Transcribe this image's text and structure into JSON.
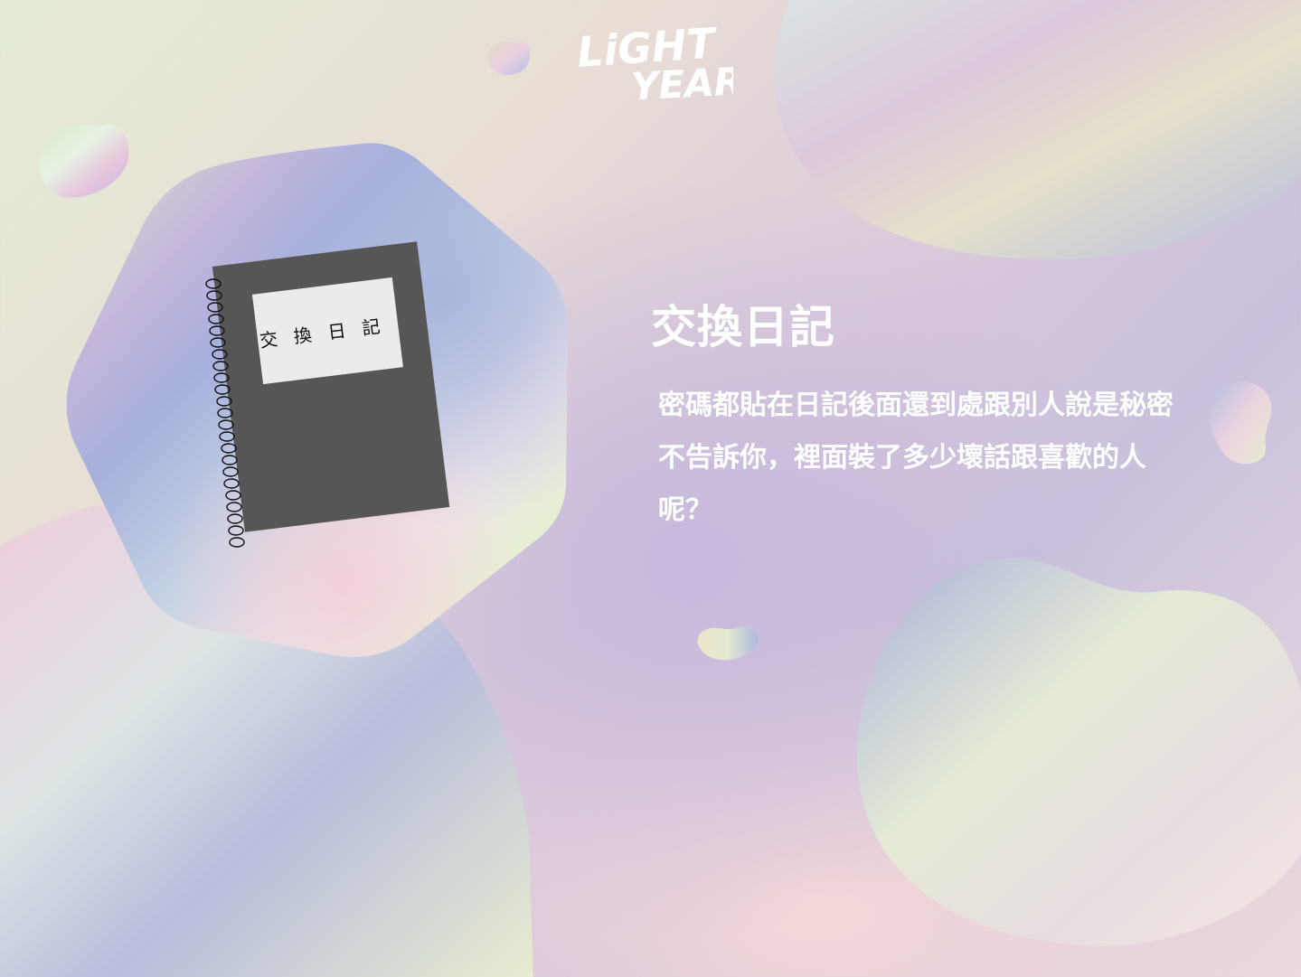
{
  "brand": {
    "logo_line1": "LiGHT",
    "logo_line2": "YEAR"
  },
  "illustration": {
    "notebook_label": "交換日記"
  },
  "content": {
    "title": "交換日記",
    "description": "密碼都貼在日記後面還到處跟別人說是秘密不告訴你，裡面裝了多少壞話跟喜歡的人呢？"
  }
}
